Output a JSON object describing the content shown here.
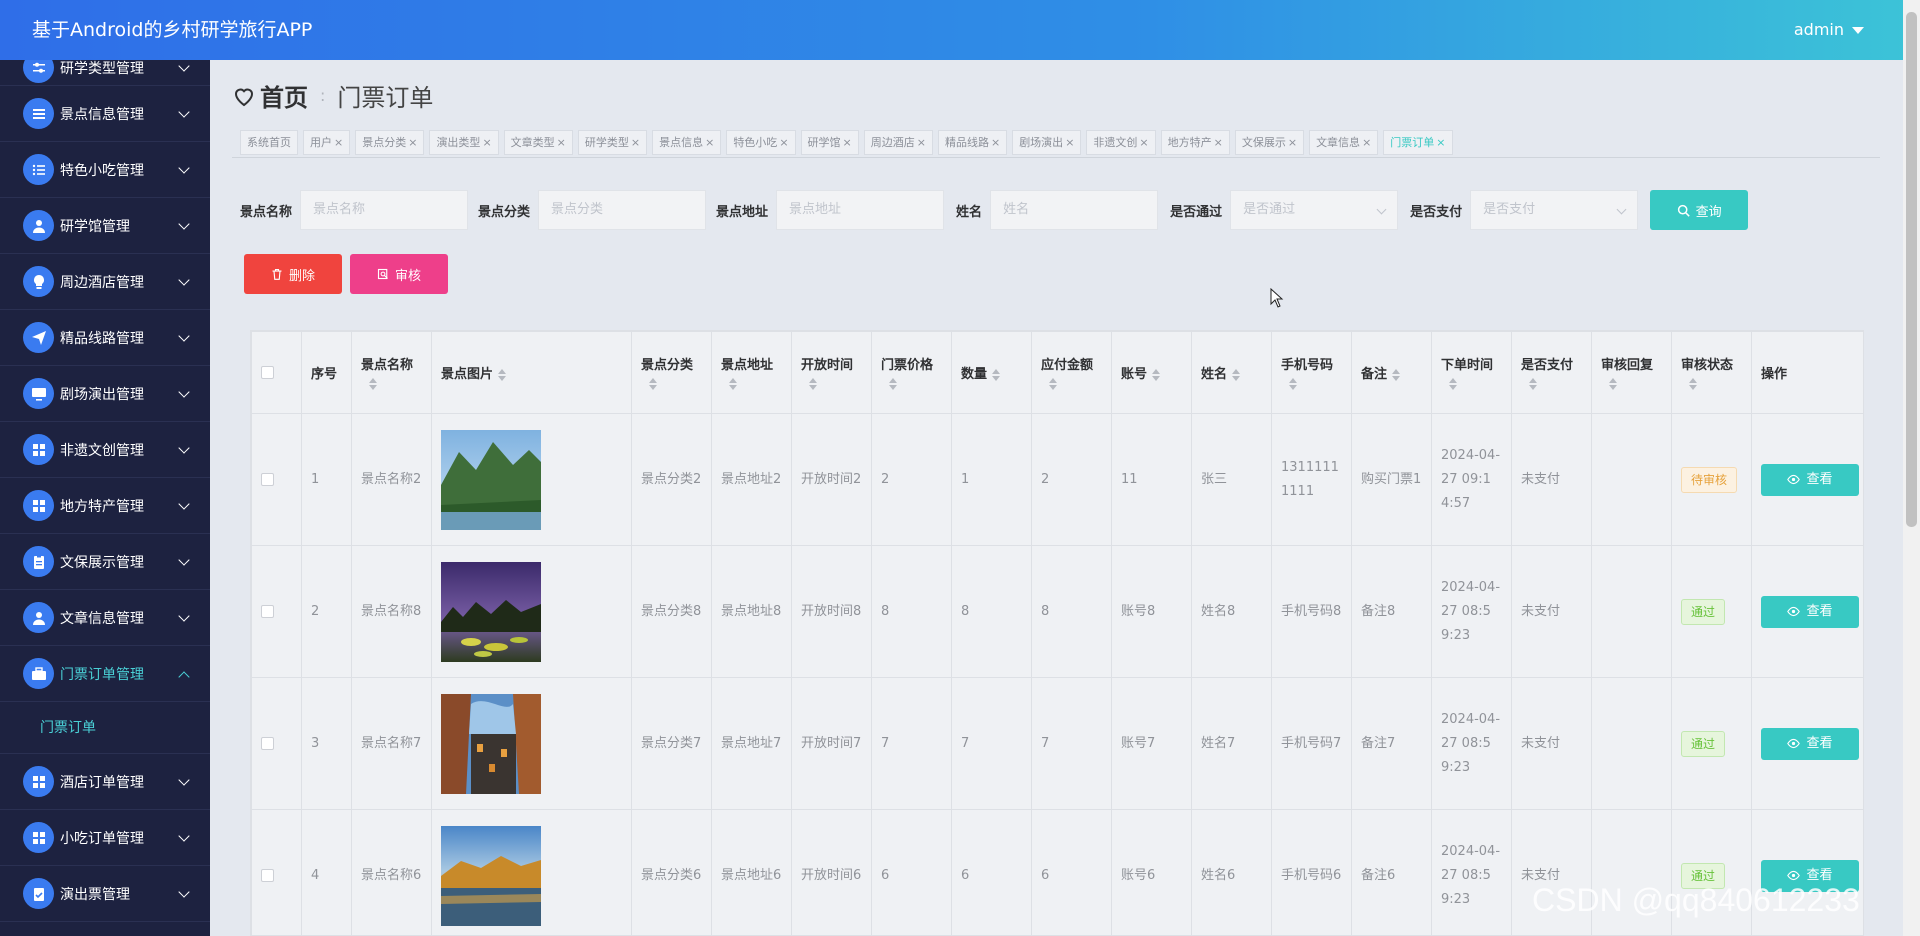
{
  "header": {
    "app_title": "基于Android的乡村研学旅行APP",
    "user": "admin"
  },
  "sidebar": {
    "items": [
      {
        "label": "研学类型管理",
        "icon": "sliders-icon"
      },
      {
        "label": "景点信息管理",
        "icon": "list-icon"
      },
      {
        "label": "特色小吃管理",
        "icon": "list-icon"
      },
      {
        "label": "研学馆管理",
        "icon": "user-icon"
      },
      {
        "label": "周边酒店管理",
        "icon": "bulb-icon"
      },
      {
        "label": "精品线路管理",
        "icon": "send-icon"
      },
      {
        "label": "剧场演出管理",
        "icon": "monitor-icon"
      },
      {
        "label": "非遗文创管理",
        "icon": "grid-icon"
      },
      {
        "label": "地方特产管理",
        "icon": "grid-icon"
      },
      {
        "label": "文保展示管理",
        "icon": "clipboard-icon"
      },
      {
        "label": "文章信息管理",
        "icon": "user-icon"
      },
      {
        "label": "门票订单管理",
        "icon": "briefcase-icon"
      },
      {
        "label": "门票订单",
        "icon": ""
      },
      {
        "label": "酒店订单管理",
        "icon": "grid-icon"
      },
      {
        "label": "小吃订单管理",
        "icon": "grid-icon"
      },
      {
        "label": "演出票管理",
        "icon": "checklist-icon"
      }
    ]
  },
  "breadcrumb": {
    "home": "首页",
    "current": "门票订单"
  },
  "tags": [
    "系统首页",
    "用户",
    "景点分类",
    "演出类型",
    "文章类型",
    "研学类型",
    "景点信息",
    "特色小吃",
    "研学馆",
    "周边酒店",
    "精品线路",
    "剧场演出",
    "非遗文创",
    "地方特产",
    "文保展示",
    "文章信息",
    "门票订单"
  ],
  "search": {
    "fields": [
      {
        "label": "景点名称",
        "placeholder": "景点名称"
      },
      {
        "label": "景点分类",
        "placeholder": "景点分类"
      },
      {
        "label": "景点地址",
        "placeholder": "景点地址"
      },
      {
        "label": "姓名",
        "placeholder": "姓名"
      },
      {
        "label": "是否通过",
        "placeholder": "是否通过"
      },
      {
        "label": "是否支付",
        "placeholder": "是否支付"
      }
    ],
    "query_label": "查询"
  },
  "actions": {
    "delete_label": "删除",
    "audit_label": "审核"
  },
  "table": {
    "columns": [
      "",
      "序号",
      "景点名称",
      "景点图片",
      "景点分类",
      "景点地址",
      "开放时间",
      "门票价格",
      "数量",
      "应付金额",
      "账号",
      "姓名",
      "手机号码",
      "备注",
      "下单时间",
      "是否支付",
      "审核回复",
      "审核状态",
      "操作"
    ],
    "rows": [
      {
        "idx": "1",
        "name": "景点名称2",
        "image": "mountain-lake",
        "category": "景点分类2",
        "address": "景点地址2",
        "open": "开放时间2",
        "price": "2",
        "qty": "1",
        "amount": "2",
        "account": "11",
        "person": "张三",
        "phone": "13111111111",
        "note": "购买门票1",
        "time": "2024-04-27 09:14:57",
        "paid": "未支付",
        "reply": "",
        "status": "待审核",
        "status_type": "pending",
        "view": "查看"
      },
      {
        "idx": "2",
        "name": "景点名称8",
        "image": "night-pond",
        "category": "景点分类8",
        "address": "景点地址8",
        "open": "开放时间8",
        "price": "8",
        "qty": "8",
        "amount": "8",
        "account": "账号8",
        "person": "姓名8",
        "phone": "手机号码8",
        "note": "备注8",
        "time": "2024-04-27 08:59:23",
        "paid": "未支付",
        "reply": "",
        "status": "通过",
        "status_type": "pass",
        "view": "查看"
      },
      {
        "idx": "3",
        "name": "景点名称7",
        "image": "old-street",
        "category": "景点分类7",
        "address": "景点地址7",
        "open": "开放时间7",
        "price": "7",
        "qty": "7",
        "amount": "7",
        "account": "账号7",
        "person": "姓名7",
        "phone": "手机号码7",
        "note": "备注7",
        "time": "2024-04-27 08:59:23",
        "paid": "未支付",
        "reply": "",
        "status": "通过",
        "status_type": "pass",
        "view": "查看"
      },
      {
        "idx": "4",
        "name": "景点名称6",
        "image": "golden-lake",
        "category": "景点分类6",
        "address": "景点地址6",
        "open": "开放时间6",
        "price": "6",
        "qty": "6",
        "amount": "6",
        "account": "账号6",
        "person": "姓名6",
        "phone": "手机号码6",
        "note": "备注6",
        "time": "2024-04-27 08:59:23",
        "paid": "未支付",
        "reply": "",
        "status": "通过",
        "status_type": "pass",
        "view": "查看"
      }
    ]
  },
  "watermark": "CSDN @qq840612233",
  "colors": {
    "accent": "#38c9c3",
    "sidebar_bg": "#1d2240",
    "danger": "#f0443e",
    "pink": "#ee3f8a"
  }
}
